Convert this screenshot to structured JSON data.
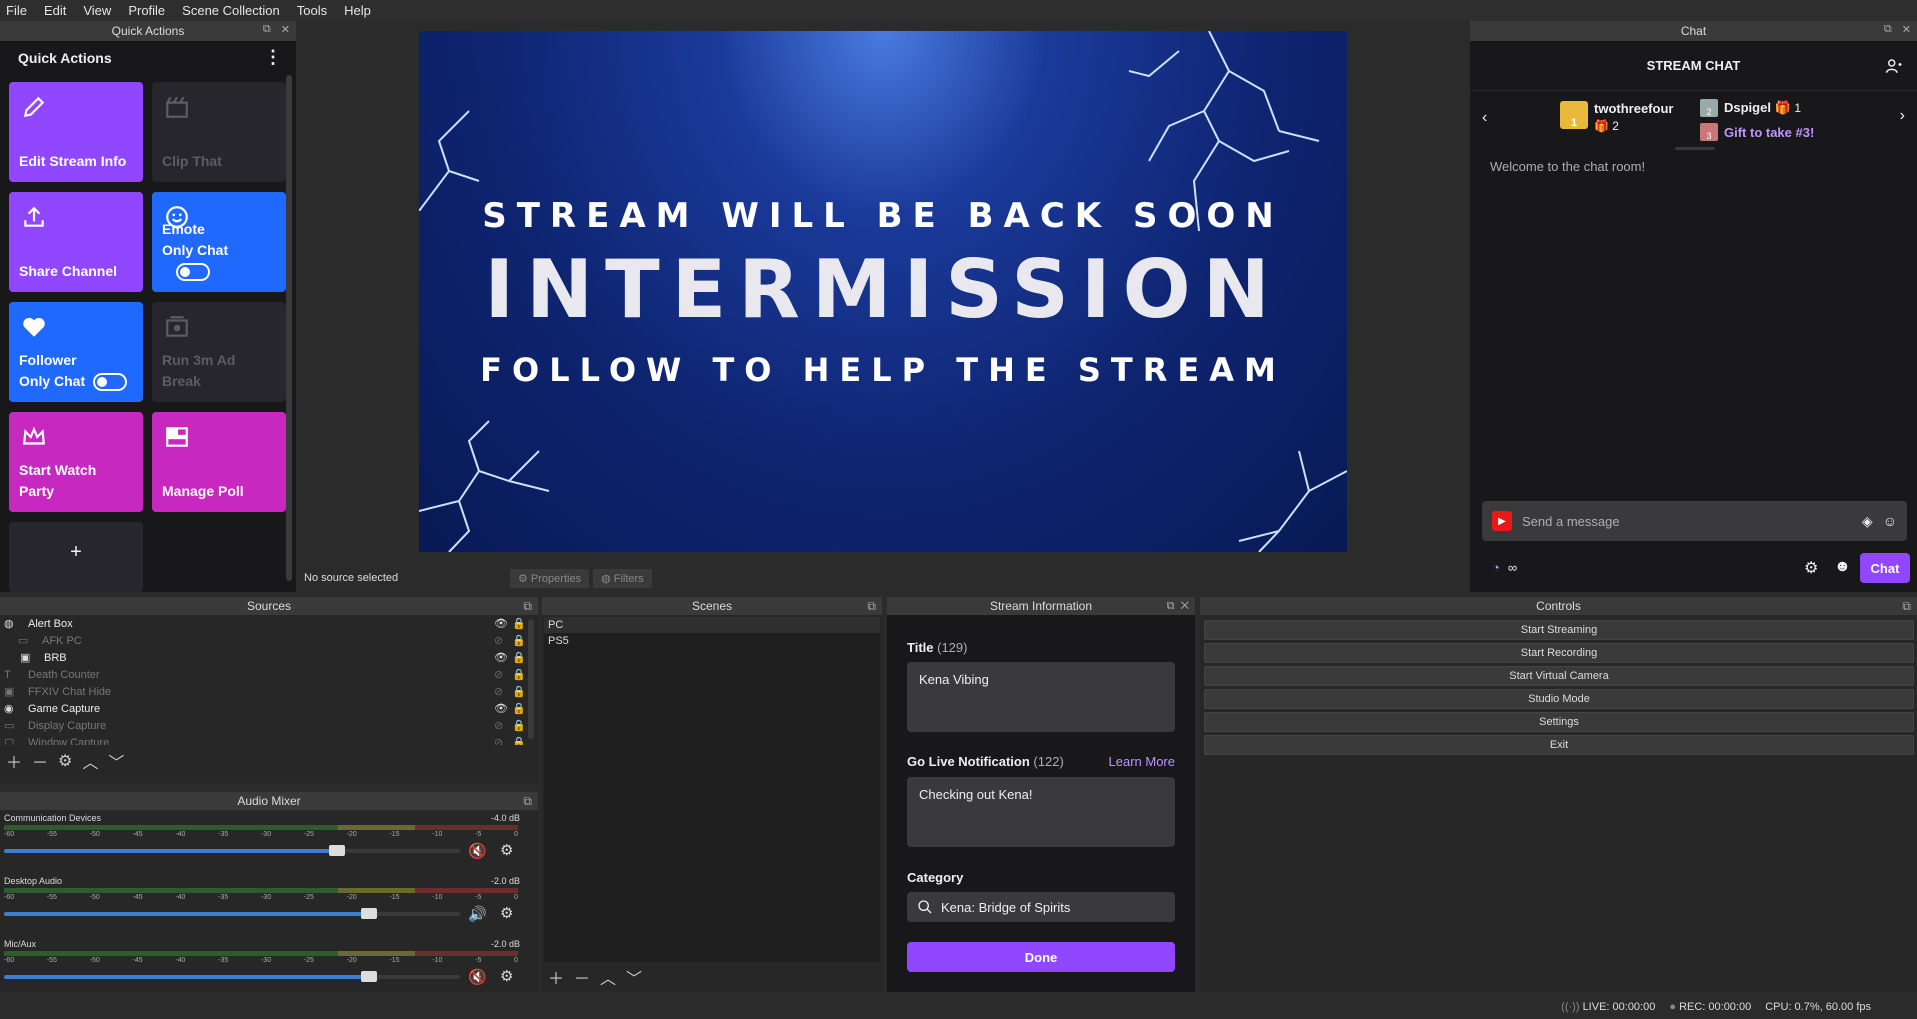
{
  "menu": [
    "File",
    "Edit",
    "View",
    "Profile",
    "Scene Collection",
    "Tools",
    "Help"
  ],
  "quick_actions": {
    "dock_title": "Quick Actions",
    "header": "Quick Actions",
    "tiles": [
      {
        "label": "Edit Stream Info",
        "icon": "pencil-icon"
      },
      {
        "label": "Clip That",
        "icon": "clapper-icon"
      },
      {
        "label": "Share Channel",
        "icon": "upload-icon"
      },
      {
        "label_1": "Emote",
        "label_2": "Only Chat",
        "icon": "smiley-icon",
        "toggle": "off"
      },
      {
        "label_1": "Follower",
        "label_2": "Only Chat",
        "icon": "heart-icon",
        "toggle": "off"
      },
      {
        "label_1": "Run 3m Ad",
        "label_2": "Break",
        "icon": "ad-icon"
      },
      {
        "label_1": "Start Watch",
        "label_2": "Party",
        "icon": "crown-icon"
      },
      {
        "label": "Manage Poll",
        "icon": "poll-icon"
      }
    ],
    "add": "+"
  },
  "preview": {
    "line1": "STREAM WILL BE BACK SOON",
    "line2": "INTERMISSION",
    "line3": "FOLLOW TO HELP THE STREAM"
  },
  "source_bar": {
    "status": "No source selected",
    "properties": "Properties",
    "filters": "Filters"
  },
  "chat": {
    "dock_title": "Chat",
    "header": "STREAM CHAT",
    "gift1_name": "twothreefour",
    "gift1_count": "2",
    "gift1_rank": "1",
    "gift2_name": "Dspigel",
    "gift2_count": "1",
    "gift2_rank": "2",
    "gift3_text": "Gift to take #3!",
    "gift3_rank": "3",
    "welcome": "Welcome to the chat room!",
    "input_placeholder": "Send a message",
    "infinity": "∞",
    "chat_button": "Chat",
    "accent": "#9147ff"
  },
  "sources": {
    "title": "Sources",
    "items": [
      {
        "name": "Alert Box",
        "visible": true,
        "dim": false
      },
      {
        "name": "AFK PC",
        "visible": false,
        "dim": true
      },
      {
        "name": "BRB",
        "visible": true,
        "dim": false
      },
      {
        "name": "Death Counter",
        "visible": false,
        "dim": true
      },
      {
        "name": "FFXIV Chat Hide",
        "visible": false,
        "dim": true
      },
      {
        "name": "Game Capture",
        "visible": true,
        "dim": false
      },
      {
        "name": "Display Capture",
        "visible": false,
        "dim": true
      },
      {
        "name": "Window Capture",
        "visible": false,
        "dim": true
      }
    ]
  },
  "scenes": {
    "title": "Scenes",
    "items": [
      "PC",
      "PS5"
    ]
  },
  "stream_info": {
    "title": "Stream Information",
    "title_label": "Title",
    "title_count": "(129)",
    "title_value": "Kena Vibing",
    "notif_label": "Go Live Notification",
    "notif_count": "(122)",
    "learn_more": "Learn More",
    "notif_value": "Checking out Kena!",
    "category_label": "Category",
    "category_value": "Kena: Bridge of Spirits",
    "done": "Done"
  },
  "controls": {
    "title": "Controls",
    "buttons": [
      "Start Streaming",
      "Start Recording",
      "Start Virtual Camera",
      "Studio Mode",
      "Settings",
      "Exit"
    ]
  },
  "mixer": {
    "title": "Audio Mixer",
    "ticks": [
      "-60",
      "-55",
      "-50",
      "-45",
      "-40",
      "-35",
      "-30",
      "-25",
      "-20",
      "-15",
      "-10",
      "-5",
      "0"
    ],
    "channels": [
      {
        "name": "Communication Devices",
        "db": "-4.0 dB",
        "level": 0.73,
        "muted": true
      },
      {
        "name": "Desktop Audio",
        "db": "-2.0 dB",
        "level": 0.8,
        "muted": false
      },
      {
        "name": "Mic/Aux",
        "db": "-2.0 dB",
        "level": 0.8,
        "muted": true
      }
    ]
  },
  "status": {
    "live": "LIVE: 00:00:00",
    "rec": "REC: 00:00:00",
    "cpu": "CPU: 0.7%, 60.00 fps"
  }
}
